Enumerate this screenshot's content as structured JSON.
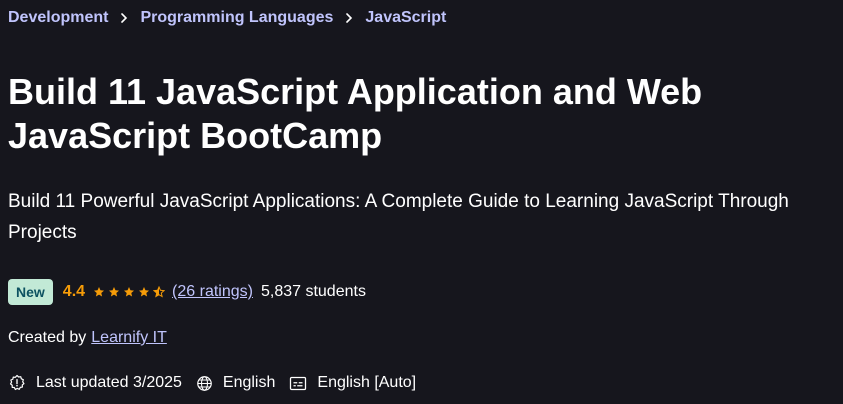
{
  "breadcrumb": {
    "items": [
      "Development",
      "Programming Languages",
      "JavaScript"
    ],
    "separator_icon": "chevron-right-icon"
  },
  "course": {
    "title_line1": "Build 11 JavaScript Application and Web",
    "title_line2": "JavaScript BootCamp",
    "subtitle": "Build 11 Powerful JavaScript Applications: A Complete Guide to Learning JavaScript Through Projects",
    "badge": "New",
    "rating_value": "4.4",
    "rating_stars": 4.4,
    "ratings_link": "(26 ratings)",
    "students": "5,837 students",
    "created_by_label": "Created by",
    "author": "Learnify IT",
    "last_updated": "Last updated 3/2025",
    "language": "English",
    "captions": "English [Auto]"
  },
  "colors": {
    "background": "#16161d",
    "link": "#c0c4fc",
    "star": "#f69c08",
    "badge_bg": "#c2e9d6",
    "badge_text": "#0d5261"
  },
  "icons": {
    "last_updated": "alert-badge-icon",
    "language": "globe-icon",
    "captions": "closed-captions-icon",
    "star_full": "star-icon",
    "star_half": "star-half-icon"
  }
}
